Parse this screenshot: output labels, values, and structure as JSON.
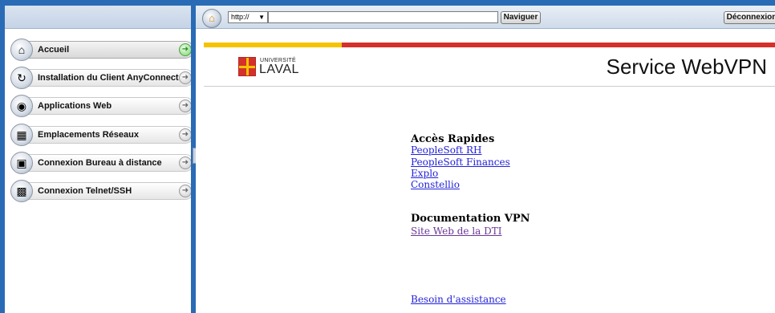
{
  "sidebar": {
    "items": [
      {
        "label": "Accueil",
        "icon": "home-icon",
        "active": true
      },
      {
        "label": "Installation du Client AnyConnect",
        "icon": "install-icon",
        "active": false
      },
      {
        "label": "Applications Web",
        "icon": "globe-icon",
        "active": false
      },
      {
        "label": "Emplacements Réseaux",
        "icon": "network-folder-icon",
        "active": false
      },
      {
        "label": "Connexion Bureau à distance",
        "icon": "remote-desktop-icon",
        "active": false
      },
      {
        "label": "Connexion Telnet/SSH",
        "icon": "terminal-icon",
        "active": false
      }
    ]
  },
  "toolbar": {
    "protocol": "http://",
    "url_value": "",
    "navigate_label": "Naviguer",
    "logout_label": "Déconnexion"
  },
  "header": {
    "logo_top": "UNIVERSITÉ",
    "logo_bottom": "LAVAL",
    "title": "Service WebVPN"
  },
  "main": {
    "quick_access_title": "Accès Rapides",
    "quick_links": [
      "PeopleSoft RH",
      "PeopleSoft Finances",
      "Explo",
      "Constellio"
    ],
    "docs_title": "Documentation VPN",
    "docs_link": "Site Web de la DTI",
    "help_link": "Besoin d'assistance"
  },
  "colors": {
    "frame_blue": "#2a6bb5",
    "band_yellow": "#f6c300",
    "band_red": "#d4312c",
    "link": "#2323d9",
    "visited_link": "#6b3796"
  }
}
